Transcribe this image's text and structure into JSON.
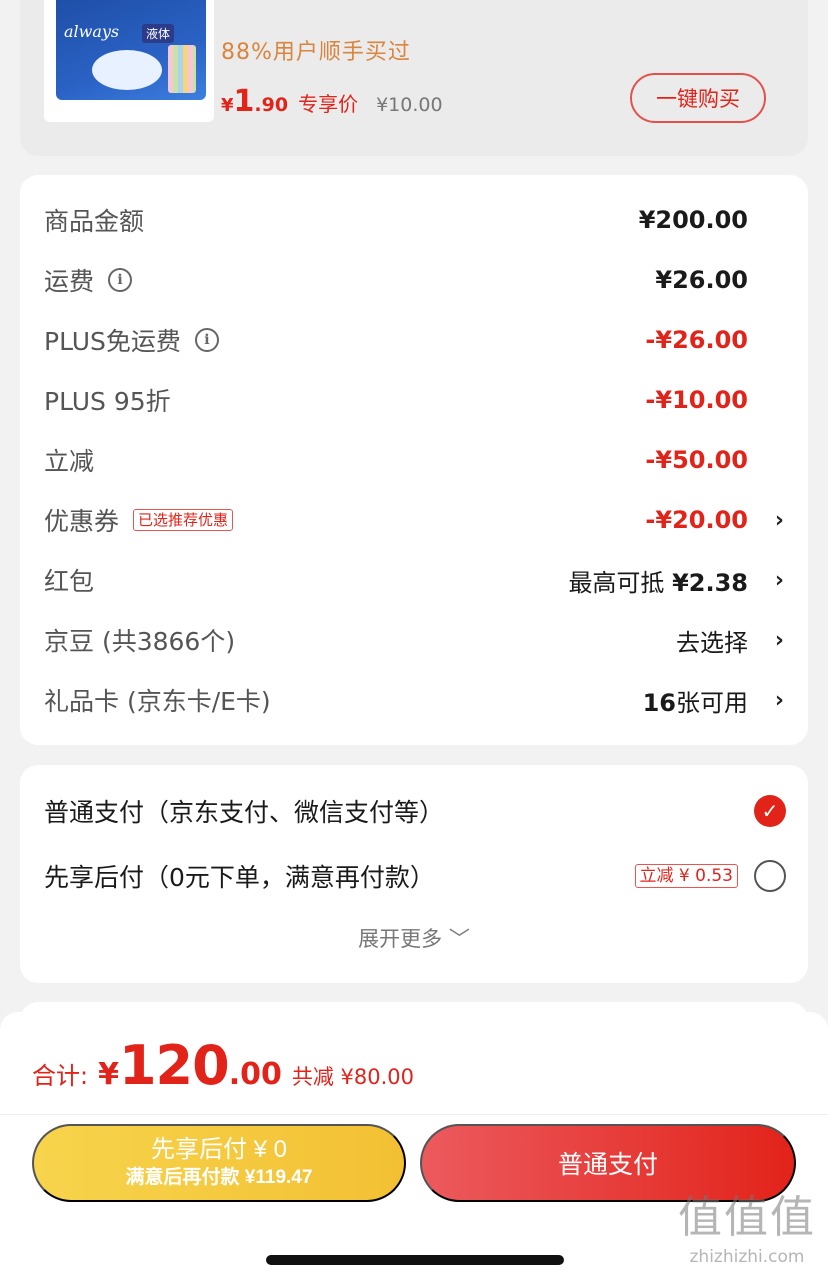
{
  "product": {
    "brand_logo": "always",
    "brand_badge": "液体",
    "buy_hint": "88%用户顺手买过",
    "price_yen": "¥",
    "price_int": "1",
    "price_dec": ".90",
    "price_tag": "专享价",
    "price_original": "¥10.00",
    "quick_buy_label": "一键购买"
  },
  "summary": {
    "items": [
      {
        "label": "商品金额",
        "value": "¥200.00"
      },
      {
        "label": "运费",
        "value": "¥26.00"
      },
      {
        "label": "PLUS免运费",
        "value": "-¥26.00"
      },
      {
        "label": "PLUS 95折",
        "value": "-¥10.00"
      },
      {
        "label": "立减",
        "value": "-¥50.00"
      },
      {
        "label": "优惠券",
        "badge": "已选推荐优惠",
        "value": "-¥20.00"
      },
      {
        "label": "红包",
        "value_prefix": "最高可抵 ",
        "value": "¥2.38"
      },
      {
        "label": "京豆 (共3866个)",
        "value": "去选择"
      },
      {
        "label": "礼品卡 (京东卡/E卡)",
        "value_prefix": "16",
        "value": "张可用"
      }
    ],
    "info_glyph": "i",
    "chevron_glyph": "›"
  },
  "payment": {
    "options": [
      {
        "label": "普通支付（京东支付、微信支付等）",
        "selected": true
      },
      {
        "label": "先享后付（0元下单，满意再付款）",
        "badge": "立减 ¥ 0.53",
        "selected": false
      }
    ],
    "check_glyph": "✓",
    "expand_label": "展开更多 ﹀"
  },
  "footer": {
    "total_label": "合计:",
    "total_yen": "¥",
    "total_int": "120",
    "total_dec": ".00",
    "total_saving": "共减 ¥80.00",
    "later_pay_line1": "先享后付 ¥ 0",
    "later_pay_line2": "满意后再付款 ¥119.47",
    "normal_pay_label": "普通支付"
  },
  "watermark": {
    "main": "值值值",
    "sub": "zhizhizhi.com"
  },
  "colors": {
    "accent": "#e2231a",
    "later_pay": "#f3c033",
    "hint_orange": "#d9853e"
  }
}
